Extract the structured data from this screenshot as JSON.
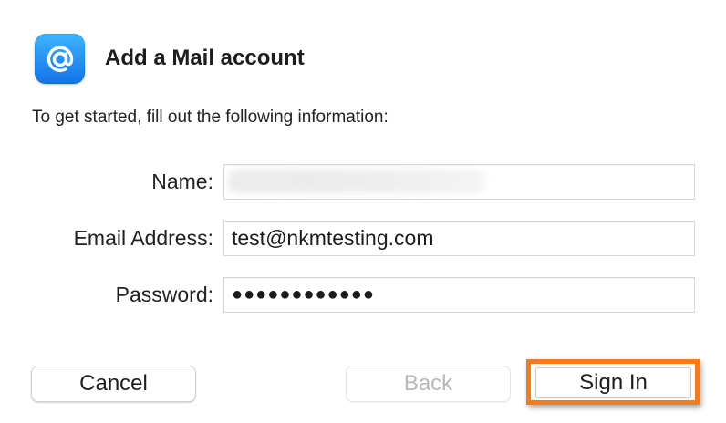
{
  "dialog": {
    "title": "Add a Mail account",
    "intro": "To get started, fill out the following information:",
    "app_icon": "at-sign-icon",
    "accent_color": "#1a86f0"
  },
  "form": {
    "name": {
      "label": "Name:",
      "value": ""
    },
    "email": {
      "label": "Email Address:",
      "value": "test@nkmtesting.com"
    },
    "password": {
      "label": "Password:",
      "value": "●●●●●●●●●●●●"
    }
  },
  "buttons": {
    "cancel": "Cancel",
    "back": "Back",
    "sign_in": "Sign In"
  },
  "annotation": {
    "highlight_color": "#f47b20"
  }
}
